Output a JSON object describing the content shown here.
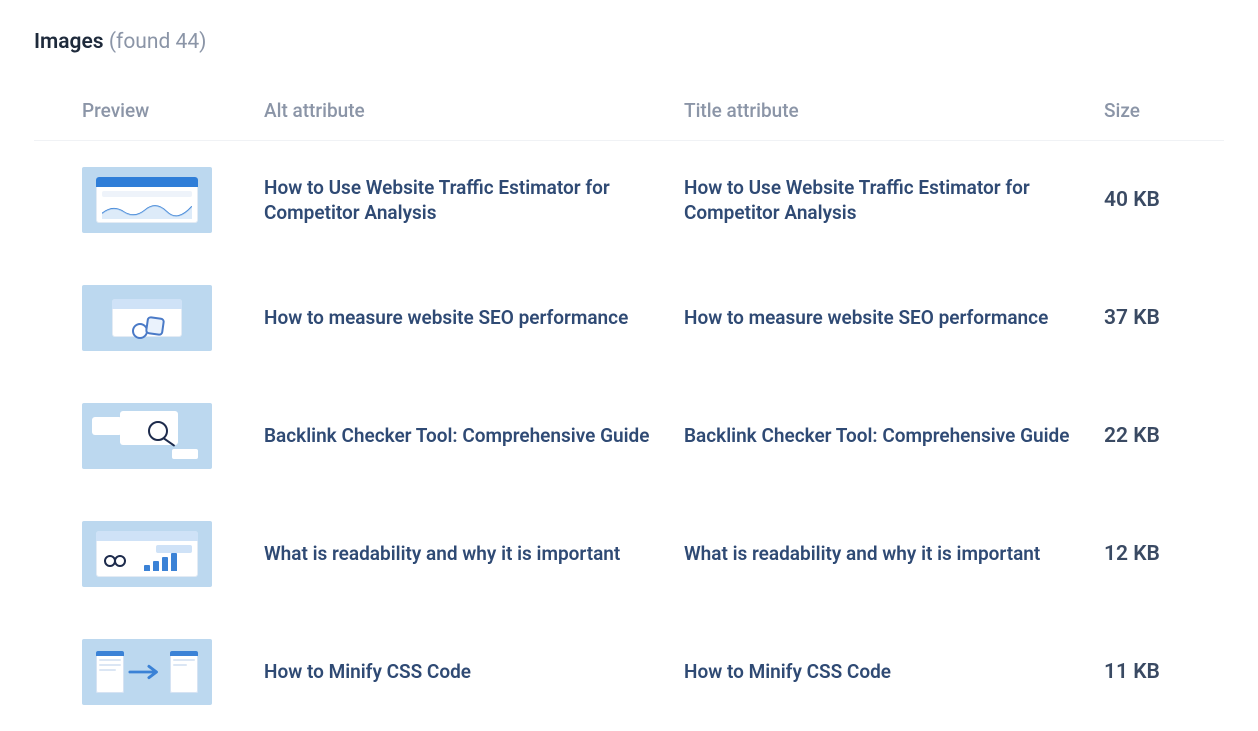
{
  "header": {
    "title_label": "Images",
    "count_text": "(found 44)"
  },
  "columns": {
    "preview": "Preview",
    "alt": "Alt attribute",
    "title": "Title attribute",
    "size": "Size"
  },
  "rows": [
    {
      "alt": "How to Use Website Traffic Estimator for Competitor Analysis",
      "title": "How to Use Website Traffic Estimator for Competitor Analysis",
      "size": "40 KB"
    },
    {
      "alt": "How to measure website SEO performance",
      "title": "How to measure website SEO performance",
      "size": "37 KB"
    },
    {
      "alt": "Backlink Checker Tool: Comprehensive Guide",
      "title": "Backlink Checker Tool: Comprehensive Guide",
      "size": "22 KB"
    },
    {
      "alt": "What is readability and why it is important",
      "title": "What is readability and why it is important",
      "size": "12 KB"
    },
    {
      "alt": "How to Minify CSS Code",
      "title": "How to Minify CSS Code",
      "size": "11 KB"
    }
  ]
}
